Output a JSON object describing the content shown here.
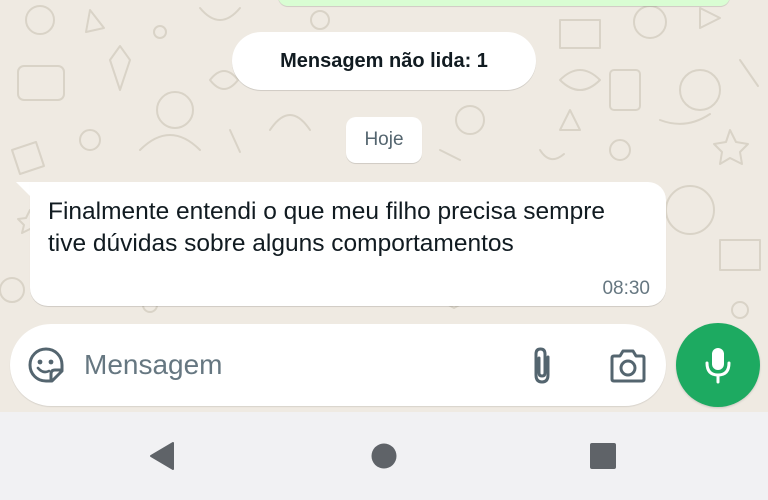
{
  "chat": {
    "unread_label": "Mensagem não lida: 1",
    "date_label": "Hoje",
    "message": {
      "text": "Finalmente entendi o que meu filho precisa sempre tive dúvidas sobre alguns comportamentos",
      "time": "08:30"
    }
  },
  "composer": {
    "placeholder": "Mensagem",
    "value": "",
    "icons": {
      "emoji": "sticker-emoji-icon",
      "attach": "paperclip-icon",
      "camera": "camera-icon",
      "mic": "microphone-icon"
    }
  },
  "navigation": {
    "icons": [
      "back-triangle-icon",
      "home-circle-icon",
      "recents-square-icon"
    ]
  },
  "colors": {
    "chat_background": "#efeae2",
    "incoming_bubble": "#ffffff",
    "outgoing_bubble": "#d9fdd3",
    "accent_green": "#1daa61",
    "nav_background": "#f1f1f3",
    "nav_icon": "#5f6368"
  }
}
